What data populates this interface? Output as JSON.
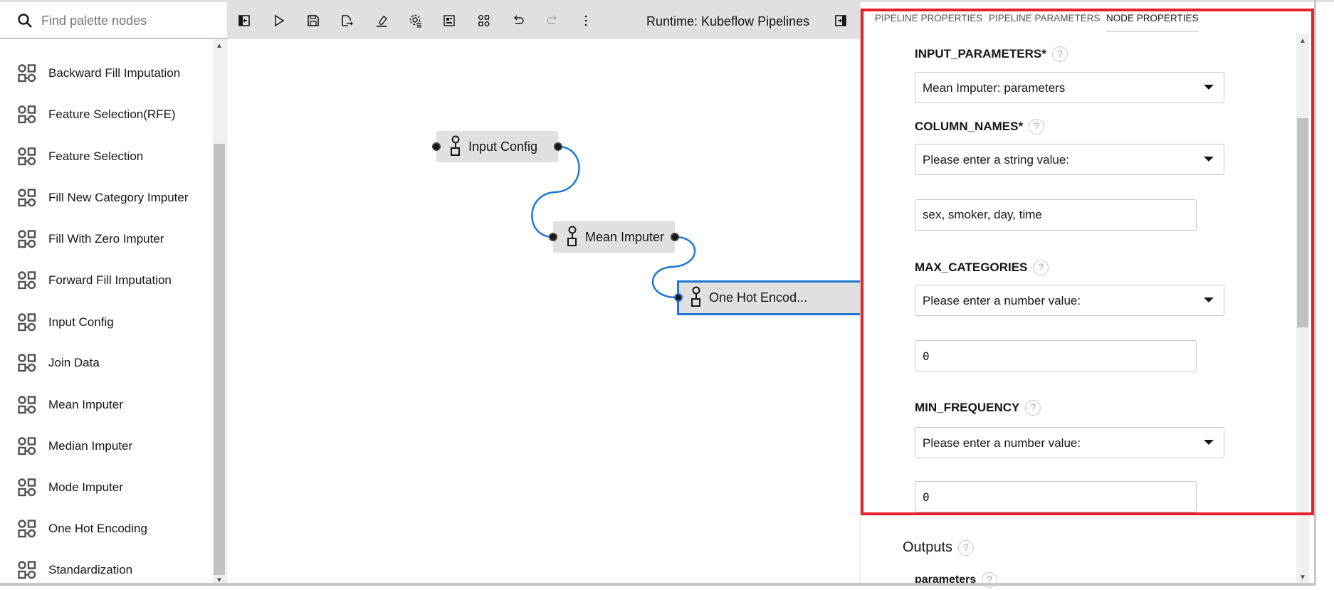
{
  "search": {
    "placeholder": "Find palette nodes",
    "icon": "search-icon"
  },
  "palette": {
    "items": [
      {
        "label": "Backward Fill Imputation"
      },
      {
        "label": "Feature Selection(RFE)"
      },
      {
        "label": "Feature Selection"
      },
      {
        "label": "Fill New Category Imputer"
      },
      {
        "label": "Fill With Zero Imputer"
      },
      {
        "label": "Forward Fill Imputation"
      },
      {
        "label": "Input Config"
      },
      {
        "label": "Join Data"
      },
      {
        "label": "Mean Imputer"
      },
      {
        "label": "Median Imputer"
      },
      {
        "label": "Mode Imputer"
      },
      {
        "label": "One Hot Encoding"
      },
      {
        "label": "Standardization"
      }
    ]
  },
  "toolbar": {
    "icons": [
      "open-palette-icon",
      "run-icon",
      "save-icon",
      "export-icon",
      "clear-icon",
      "runtimes-icon",
      "component-catalog-icon",
      "arrange-icon",
      "undo-icon",
      "redo-icon",
      "more-icon"
    ],
    "runtime": "Runtime: Kubeflow Pipelines",
    "right_icon": "open-panel-icon"
  },
  "canvas": {
    "nodes": [
      {
        "label": "Input Config"
      },
      {
        "label": "Mean Imputer"
      },
      {
        "label": "One Hot Encod...",
        "selected": true
      }
    ],
    "link_color": "#1f78d1"
  },
  "panel": {
    "tabs": [
      "PIPELINE PROPERTIES",
      "PIPELINE PARAMETERS",
      "NODE PROPERTIES"
    ],
    "active_tab": "NODE PROPERTIES",
    "fields": [
      {
        "label": "INPUT_PARAMETERS*",
        "select": "Mean Imputer: parameters"
      },
      {
        "label": "COLUMN_NAMES*",
        "select": "Please enter a string value:",
        "value": "sex, smoker, day, time"
      },
      {
        "label": "MAX_CATEGORIES",
        "select": "Please enter a number value:",
        "value": "0"
      },
      {
        "label": "MIN_FREQUENCY",
        "select": "Please enter a number value:",
        "value": "0"
      }
    ],
    "outputs_heading": "Outputs",
    "output_name": "parameters",
    "help": "?"
  },
  "highlight_color": "#e8202a"
}
